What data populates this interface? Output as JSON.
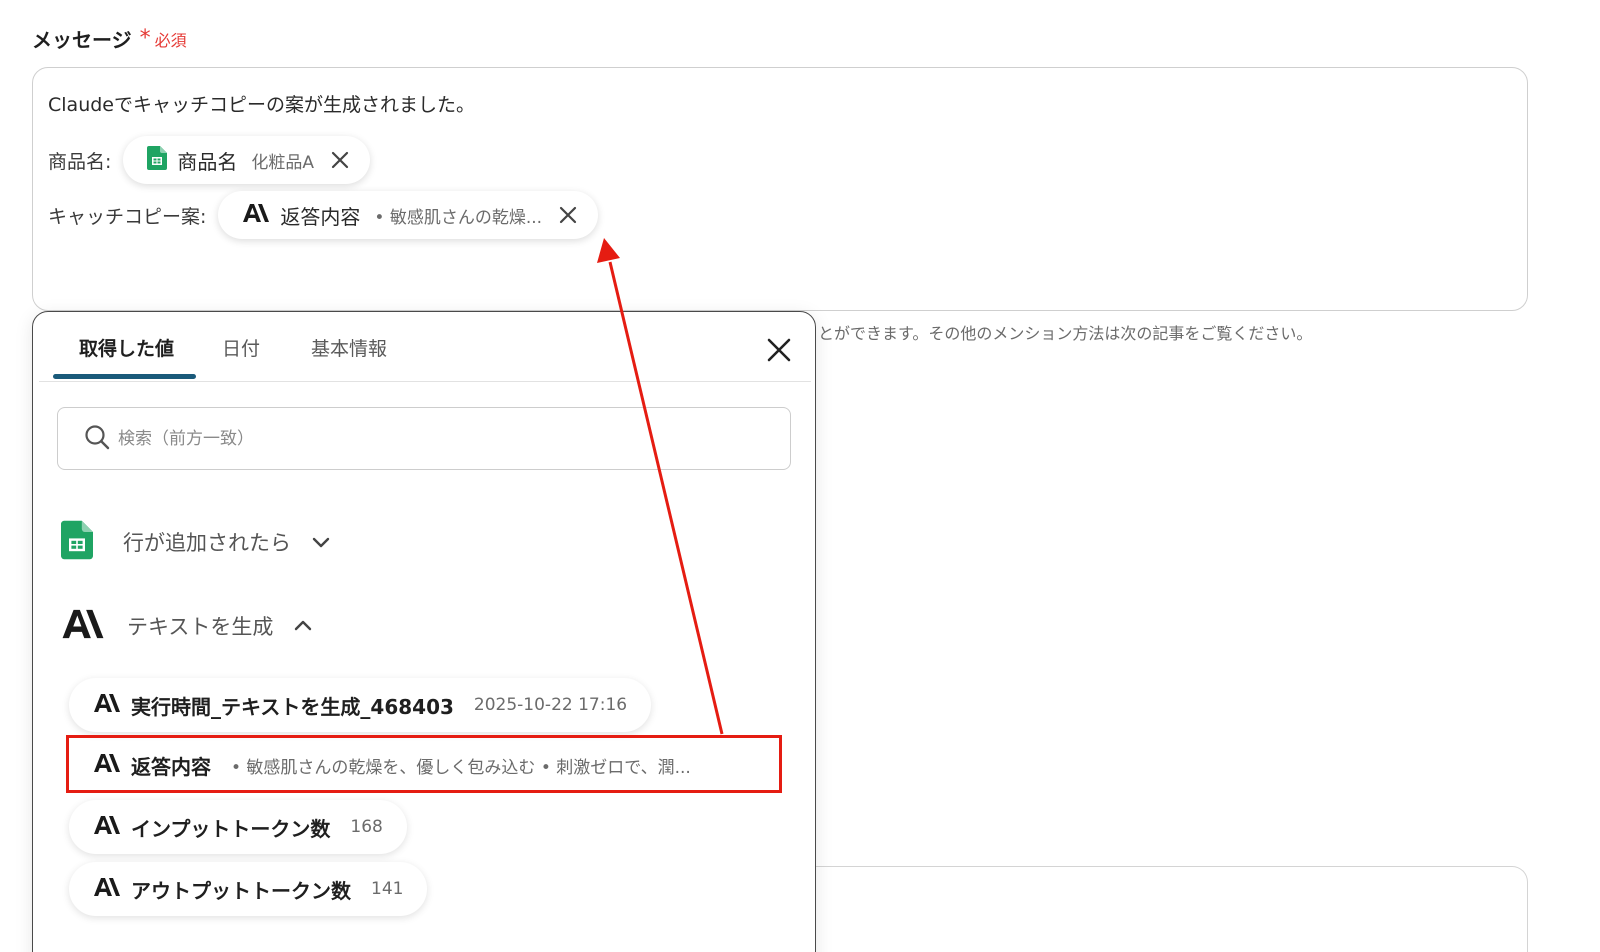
{
  "field": {
    "label": "メッセージ",
    "required_star": "*",
    "required_text": "必須"
  },
  "message": {
    "line1": "Claudeでキャッチコピーの案が生成されました。",
    "row1": {
      "label": "商品名:",
      "chip_title": "商品名",
      "chip_value": "化粧品A",
      "chip_icon": "google-sheets-icon"
    },
    "row2": {
      "label": "キャッチコピー案:",
      "chip_title": "返答内容",
      "chip_value": "• 敏感肌さんの乾燥...",
      "chip_icon": "anthropic-icon"
    }
  },
  "helper_text": "とができます。その他のメンション方法は次の記事をご覧ください。",
  "panel": {
    "tabs": [
      {
        "label": "取得した値",
        "active": true
      },
      {
        "label": "日付",
        "active": false
      },
      {
        "label": "基本情報",
        "active": false
      }
    ],
    "search_placeholder": "検索（前方一致）",
    "groups": [
      {
        "label": "行が追加されたら",
        "icon": "google-sheets-icon",
        "expanded": false
      },
      {
        "label": "テキストを生成",
        "icon": "anthropic-icon",
        "expanded": true
      }
    ],
    "items": [
      {
        "title": "実行時間_テキストを生成_468403",
        "value": "2025-10-22 17:16"
      },
      {
        "title": "返答内容",
        "value": "• 敏感肌さんの乾燥を、優しく包み込む • 刺激ゼロで、潤..."
      },
      {
        "title": "インプットトークン数",
        "value": "168"
      },
      {
        "title": "アウトプットトークン数",
        "value": "141"
      }
    ]
  },
  "colors": {
    "accent_tab": "#1a5a7a",
    "required": "#e53935",
    "annotation": "#e51c12",
    "sheets_green": "#1fa463"
  }
}
